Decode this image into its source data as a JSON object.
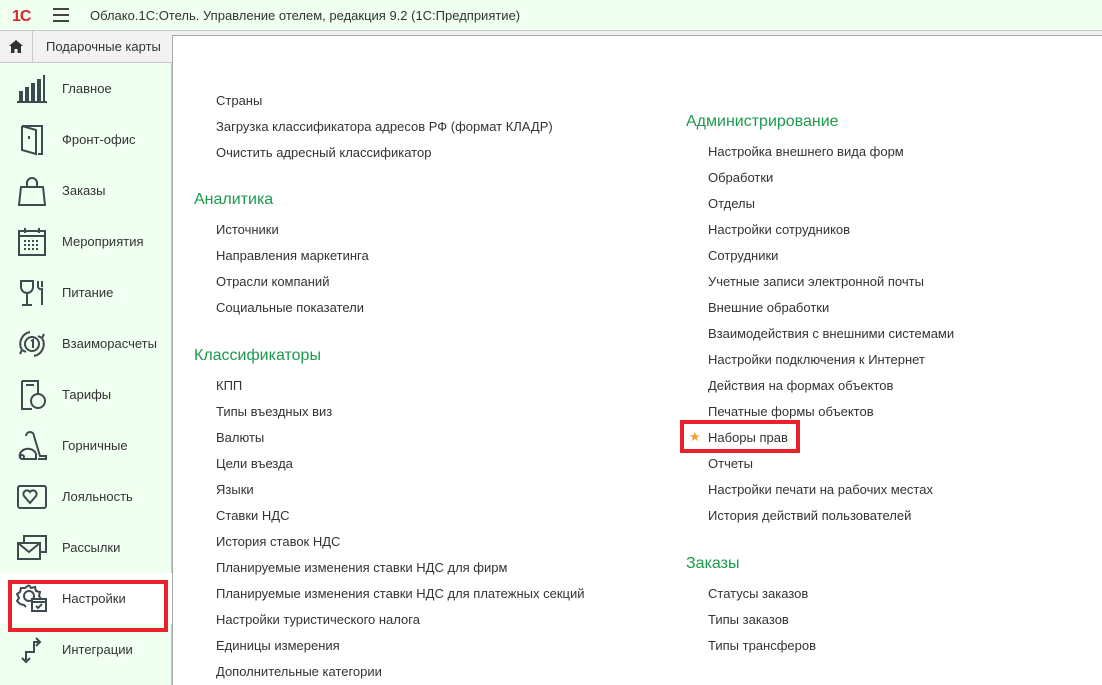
{
  "app": {
    "logo": "1С",
    "title": "Облако.1С:Отель. Управление отелем, редакция 9.2  (1С:Предприятие)"
  },
  "tabs": {
    "current": "Подарочные карты"
  },
  "sidebar": {
    "items": [
      {
        "label": "Главное",
        "icon": "chart-bars-icon"
      },
      {
        "label": "Фронт-офис",
        "icon": "door-icon"
      },
      {
        "label": "Заказы",
        "icon": "shopping-bag-icon"
      },
      {
        "label": "Мероприятия",
        "icon": "calendar-icon"
      },
      {
        "label": "Питание",
        "icon": "glass-fork-icon"
      },
      {
        "label": "Взаиморасчеты",
        "icon": "cycle-coin-icon"
      },
      {
        "label": "Тарифы",
        "icon": "tariff-icon"
      },
      {
        "label": "Горничные",
        "icon": "vacuum-icon"
      },
      {
        "label": "Лояльность",
        "icon": "heart-card-icon"
      },
      {
        "label": "Рассылки",
        "icon": "envelope-icon"
      },
      {
        "label": "Настройки",
        "icon": "gear-icon",
        "selected": true
      },
      {
        "label": "Интеграции",
        "icon": "arrows-icon"
      }
    ]
  },
  "left": {
    "top": [
      "Страны",
      "Загрузка классификатора адресов РФ (формат КЛАДР)",
      "Очистить адресный классификатор"
    ],
    "sections": [
      {
        "title": "Аналитика",
        "items": [
          "Источники",
          "Направления маркетинга",
          "Отрасли компаний",
          "Социальные показатели"
        ]
      },
      {
        "title": "Классификаторы",
        "items": [
          "КПП",
          "Типы въездных виз",
          "Валюты",
          "Цели въезда",
          "Языки",
          "Ставки НДС",
          "История ставок НДС",
          "Планируемые изменения ставки НДС для фирм",
          "Планируемые изменения ставки НДС для платежных секций",
          "Настройки туристического налога",
          "Единицы измерения",
          "Дополнительные категории"
        ]
      }
    ]
  },
  "right": {
    "sections": [
      {
        "title": "Администрирование",
        "items": [
          "Настройка внешнего вида форм",
          "Обработки",
          "Отделы",
          "Настройки сотрудников",
          "Сотрудники",
          "Учетные записи электронной почты",
          "Внешние обработки",
          "Взаимодействия с внешними системами",
          "Настройки подключения к Интернет",
          "Действия на формах объектов",
          "Печатные формы объектов",
          "Наборы прав",
          "Отчеты",
          "Настройки печати на рабочих местах",
          "История действий пользователей"
        ]
      },
      {
        "title": "Заказы",
        "items": [
          "Статусы заказов",
          "Типы заказов",
          "Типы трансферов"
        ]
      }
    ]
  },
  "colors": {
    "accent": "#1b9a4c",
    "highlight": "#e8212b",
    "sidebar_bg": "#effff0"
  }
}
